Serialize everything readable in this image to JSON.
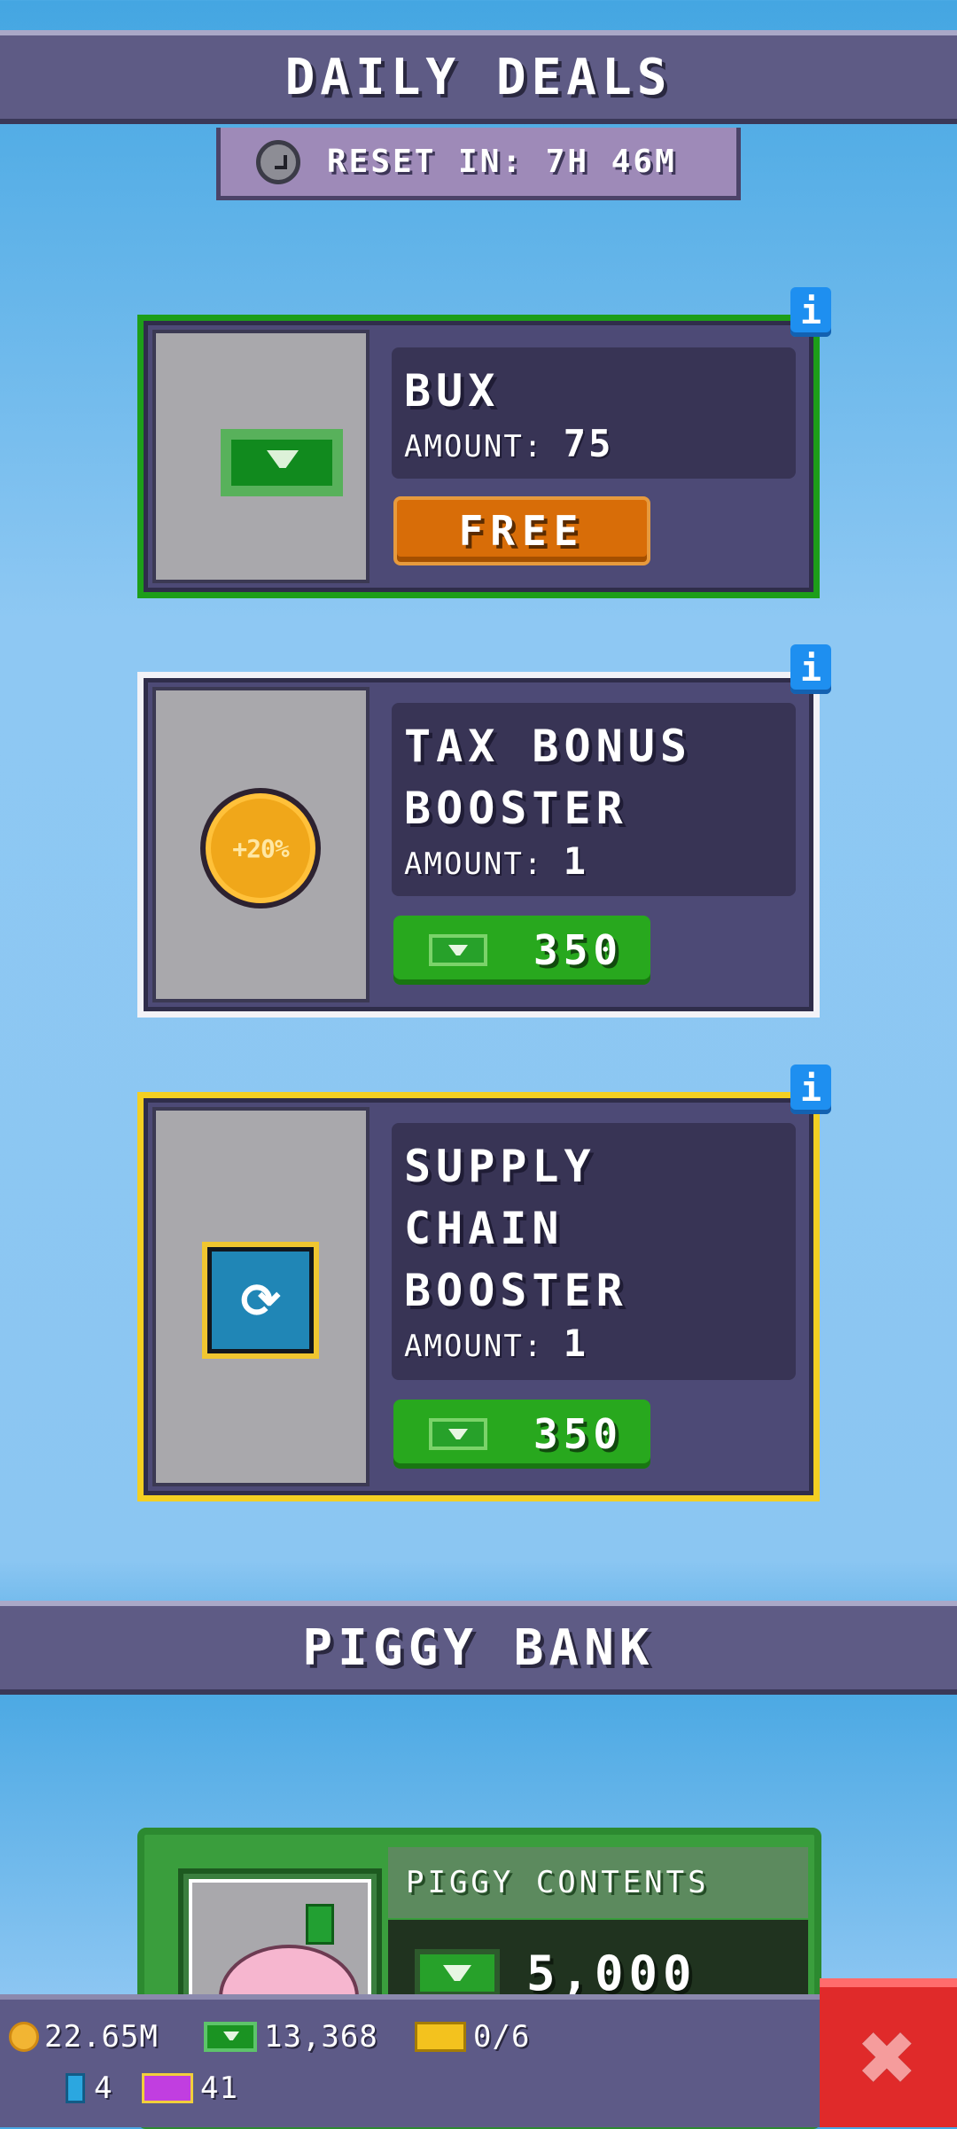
{
  "daily_deals": {
    "title": "DAILY DEALS",
    "reset_text": "RESET IN: 7H 46M",
    "deals": [
      {
        "name": "BUX",
        "amount_label": "AMOUNT:",
        "amount": "75",
        "button_label": "FREE",
        "border": "#1d9e19",
        "icon": "cash-icon"
      },
      {
        "name_line1": "TAX BONUS",
        "name_line2": "BOOSTER",
        "amount_label": "AMOUNT:",
        "amount": "1",
        "price": "350",
        "coin_text": "+20%",
        "border": "#f2f2f7",
        "icon": "tax-coin-icon"
      },
      {
        "name_line1": "SUPPLY",
        "name_line2": "CHAIN",
        "name_line3": "BOOSTER",
        "amount_label": "AMOUNT:",
        "amount": "1",
        "price": "350",
        "border": "#f3cf22",
        "icon": "supply-chain-icon"
      }
    ],
    "info_label": "i"
  },
  "piggy_bank": {
    "title": "PIGGY BANK",
    "contents_label": "PIGGY CONTENTS",
    "contents_amount": "5,000"
  },
  "resources": {
    "coins": "22.65M",
    "bux": "13,368",
    "tickets": "0/6",
    "gems": "4",
    "passes": "41"
  },
  "close_label": "✖"
}
